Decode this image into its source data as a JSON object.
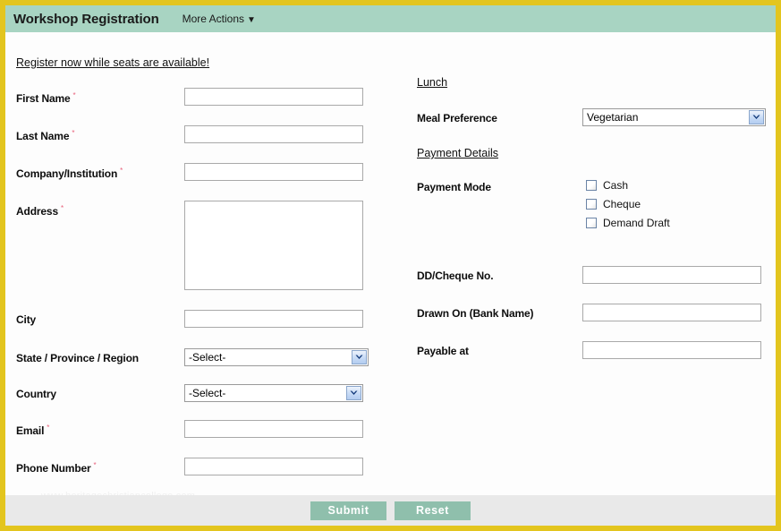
{
  "header": {
    "title": "Workshop Registration",
    "more_actions_label": "More Actions",
    "caret_icon": "chevron-down-icon",
    "band_color": "#a8d4c2"
  },
  "border_color": "#e3c51e",
  "intro_text": "Register now while seats are available!",
  "required_marker": "*",
  "left_column": {
    "fields": [
      {
        "label": "First Name",
        "required": true,
        "type": "text",
        "value": ""
      },
      {
        "label": "Last Name",
        "required": true,
        "type": "text",
        "value": ""
      },
      {
        "label": "Company/Institution",
        "required": true,
        "type": "text",
        "value": ""
      },
      {
        "label": "Address",
        "required": true,
        "type": "textarea",
        "value": ""
      },
      {
        "label": "City",
        "required": false,
        "type": "text",
        "value": ""
      },
      {
        "label": "State / Province / Region",
        "required": false,
        "type": "select",
        "value": "-Select-"
      },
      {
        "label": "Country",
        "required": false,
        "type": "select",
        "value": "-Select-"
      },
      {
        "label": "Email",
        "required": true,
        "type": "text",
        "value": ""
      },
      {
        "label": "Phone Number",
        "required": true,
        "type": "text",
        "value": ""
      }
    ]
  },
  "right_column": {
    "lunch_heading": "Lunch",
    "meal_label": "Meal Preference",
    "meal_value": "Vegetarian",
    "payment_heading": "Payment Details",
    "payment_mode_label": "Payment Mode",
    "payment_modes": [
      {
        "label": "Cash",
        "checked": false
      },
      {
        "label": "Cheque",
        "checked": false
      },
      {
        "label": "Demand Draft",
        "checked": false
      }
    ],
    "fields": [
      {
        "label": "DD/Cheque No.",
        "value": ""
      },
      {
        "label": "Drawn On (Bank Name)",
        "value": ""
      },
      {
        "label": "Payable at",
        "value": ""
      }
    ]
  },
  "watermark": "www.heritagechristiancollege.com",
  "footer": {
    "submit_label": "Submit",
    "reset_label": "Reset",
    "button_color": "#8fbfac",
    "background_color": "#e9e9e9"
  }
}
